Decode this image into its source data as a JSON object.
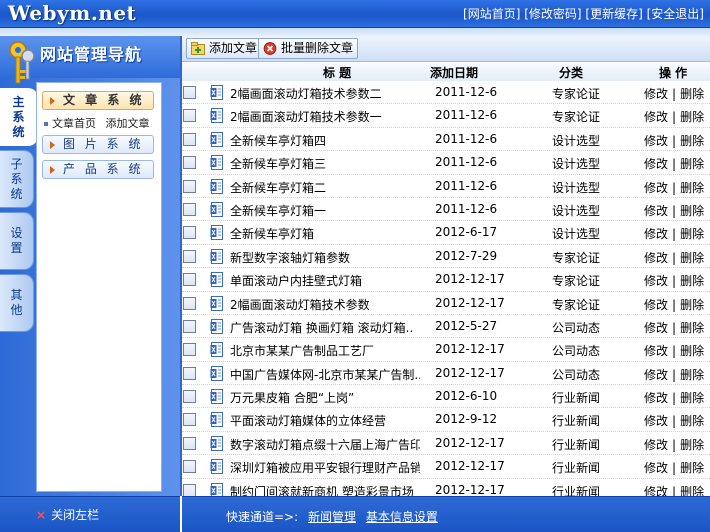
{
  "brand": {
    "logo": "Webym.net"
  },
  "top_links": [
    "[网站首页]",
    "[修改密码]",
    "[更新缓存]",
    "[安全退出]"
  ],
  "nav": {
    "title": "网站管理导航",
    "vertical_tabs": [
      "主系统",
      "子系统",
      "设置",
      "其他"
    ],
    "sections": [
      "文 章 系 统",
      "图 片 系 统",
      "产 品 系 统"
    ],
    "article_sub_items": [
      "文章首页",
      "添加文章"
    ],
    "close_left": "关闭左栏"
  },
  "toolbar": {
    "add": "添加文章",
    "batch_delete": "批量删除文章"
  },
  "table": {
    "headers": {
      "title": "标 题",
      "date": "添加日期",
      "category": "分类",
      "ops": "操 作"
    },
    "edit_label": "修改",
    "delete_label": "删除",
    "separator": "|",
    "rows": [
      {
        "title": "2幅画面滚动灯箱技术参数二",
        "date": "2011-12-6",
        "category": "专家论证"
      },
      {
        "title": "2幅画面滚动灯箱技术参数一",
        "date": "2011-12-6",
        "category": "专家论证"
      },
      {
        "title": "全新候车亭灯箱四",
        "date": "2011-12-6",
        "category": "设计选型"
      },
      {
        "title": "全新候车亭灯箱三",
        "date": "2011-12-6",
        "category": "设计选型"
      },
      {
        "title": "全新候车亭灯箱二",
        "date": "2011-12-6",
        "category": "设计选型"
      },
      {
        "title": "全新候车亭灯箱一",
        "date": "2011-12-6",
        "category": "设计选型"
      },
      {
        "title": "全新候车亭灯箱",
        "date": "2012-6-17",
        "category": "设计选型"
      },
      {
        "title": "新型数字滚轴灯箱参数",
        "date": "2012-7-29",
        "category": "专家论证"
      },
      {
        "title": "单面滚动户内挂壁式灯箱",
        "date": "2012-12-17",
        "category": "专家论证"
      },
      {
        "title": "2幅画面滚动灯箱技术参数",
        "date": "2012-12-17",
        "category": "专家论证"
      },
      {
        "title": "广告滚动灯箱 换画灯箱 滚动灯箱..",
        "date": "2012-5-27",
        "category": "公司动态"
      },
      {
        "title": "北京市某某广告制品工艺厂",
        "date": "2012-12-17",
        "category": "公司动态"
      },
      {
        "title": "中国广告媒体网-北京市某某广告制..",
        "date": "2012-12-17",
        "category": "公司动态"
      },
      {
        "title": "万元果皮箱 合肥“上岗”",
        "date": "2012-6-10",
        "category": "行业新闻"
      },
      {
        "title": "平面滚动灯箱媒体的立体经营",
        "date": "2012-9-12",
        "category": "行业新闻"
      },
      {
        "title": "数字滚动灯箱点缀十六届上海广告印..",
        "date": "2012-12-17",
        "category": "行业新闻"
      },
      {
        "title": "深圳灯箱被应用平安银行理财产品销..",
        "date": "2012-12-17",
        "category": "行业新闻"
      },
      {
        "title": "制约门间滚就新商机 塑造彩景市场",
        "date": "2012-12-17",
        "category": "行业新闻"
      }
    ]
  },
  "footer": {
    "quick_label": "快速通道=>:",
    "quick_links": [
      "新闻管理",
      "基本信息设置"
    ]
  },
  "colors": {
    "header_blue": "#1b56c9",
    "panel_blue": "#2e6ad6",
    "active_orange": "#fde3b0"
  }
}
